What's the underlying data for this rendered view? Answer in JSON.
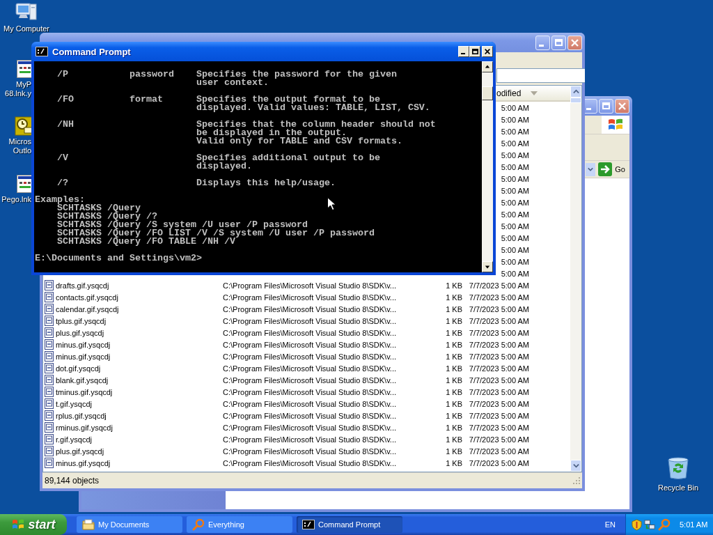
{
  "desktop": {
    "icons": [
      {
        "kind": "computer",
        "lines": [
          "My Computer"
        ]
      },
      {
        "kind": "shortcut",
        "lines": [
          "MyP",
          "68.lnk.y"
        ]
      },
      {
        "kind": "outlook",
        "lines": [
          "Micros",
          "Outlo"
        ]
      },
      {
        "kind": "shortcut",
        "lines": [
          "Pego.lnk"
        ]
      }
    ],
    "recycle_bin": {
      "label": "Recycle Bin"
    }
  },
  "explorer_window": {
    "go_button": "Go"
  },
  "everything_window": {
    "column_header": "odified",
    "partial_rows": [
      {
        "modified": "5:00 AM"
      },
      {
        "modified": "5:00 AM"
      },
      {
        "modified": "5:00 AM"
      },
      {
        "modified": "5:00 AM"
      },
      {
        "modified": "5:00 AM"
      },
      {
        "modified": "5:00 AM"
      },
      {
        "modified": "5:00 AM"
      },
      {
        "modified": "5:00 AM"
      },
      {
        "modified": "5:00 AM"
      },
      {
        "modified": "5:00 AM"
      },
      {
        "modified": "5:00 AM"
      },
      {
        "modified": "5:00 AM"
      },
      {
        "modified": "5:00 AM"
      },
      {
        "modified": "5:00 AM"
      },
      {
        "modified": "5:00 AM"
      }
    ],
    "rows": [
      {
        "name": "drafts.gif.ysqcdj",
        "path": "C:\\Program Files\\Microsoft Visual Studio 8\\SDK\\v...",
        "size": "1 KB",
        "modified": "7/7/2023 5:00 AM"
      },
      {
        "name": "contacts.gif.ysqcdj",
        "path": "C:\\Program Files\\Microsoft Visual Studio 8\\SDK\\v...",
        "size": "1 KB",
        "modified": "7/7/2023 5:00 AM"
      },
      {
        "name": "calendar.gif.ysqcdj",
        "path": "C:\\Program Files\\Microsoft Visual Studio 8\\SDK\\v...",
        "size": "1 KB",
        "modified": "7/7/2023 5:00 AM"
      },
      {
        "name": "tplus.gif.ysqcdj",
        "path": "C:\\Program Files\\Microsoft Visual Studio 8\\SDK\\v...",
        "size": "1 KB",
        "modified": "7/7/2023 5:00 AM"
      },
      {
        "name": "plus.gif.ysqcdj",
        "path": "C:\\Program Files\\Microsoft Visual Studio 8\\SDK\\v...",
        "size": "1 KB",
        "modified": "7/7/2023 5:00 AM"
      },
      {
        "name": "minus.gif.ysqcdj",
        "path": "C:\\Program Files\\Microsoft Visual Studio 8\\SDK\\v...",
        "size": "1 KB",
        "modified": "7/7/2023 5:00 AM"
      },
      {
        "name": "minus.gif.ysqcdj",
        "path": "C:\\Program Files\\Microsoft Visual Studio 8\\SDK\\v...",
        "size": "1 KB",
        "modified": "7/7/2023 5:00 AM"
      },
      {
        "name": "dot.gif.ysqcdj",
        "path": "C:\\Program Files\\Microsoft Visual Studio 8\\SDK\\v...",
        "size": "1 KB",
        "modified": "7/7/2023 5:00 AM"
      },
      {
        "name": "blank.gif.ysqcdj",
        "path": "C:\\Program Files\\Microsoft Visual Studio 8\\SDK\\v...",
        "size": "1 KB",
        "modified": "7/7/2023 5:00 AM"
      },
      {
        "name": "tminus.gif.ysqcdj",
        "path": "C:\\Program Files\\Microsoft Visual Studio 8\\SDK\\v...",
        "size": "1 KB",
        "modified": "7/7/2023 5:00 AM"
      },
      {
        "name": "t.gif.ysqcdj",
        "path": "C:\\Program Files\\Microsoft Visual Studio 8\\SDK\\v...",
        "size": "1 KB",
        "modified": "7/7/2023 5:00 AM"
      },
      {
        "name": "rplus.gif.ysqcdj",
        "path": "C:\\Program Files\\Microsoft Visual Studio 8\\SDK\\v...",
        "size": "1 KB",
        "modified": "7/7/2023 5:00 AM"
      },
      {
        "name": "rminus.gif.ysqcdj",
        "path": "C:\\Program Files\\Microsoft Visual Studio 8\\SDK\\v...",
        "size": "1 KB",
        "modified": "7/7/2023 5:00 AM"
      },
      {
        "name": "r.gif.ysqcdj",
        "path": "C:\\Program Files\\Microsoft Visual Studio 8\\SDK\\v...",
        "size": "1 KB",
        "modified": "7/7/2023 5:00 AM"
      },
      {
        "name": "plus.gif.ysqcdj",
        "path": "C:\\Program Files\\Microsoft Visual Studio 8\\SDK\\v...",
        "size": "1 KB",
        "modified": "7/7/2023 5:00 AM"
      },
      {
        "name": "minus.gif.ysqcdj",
        "path": "C:\\Program Files\\Microsoft Visual Studio 8\\SDK\\v...",
        "size": "1 KB",
        "modified": "7/7/2023 5:00 AM"
      }
    ],
    "status_bar": "89,144 objects"
  },
  "command_prompt": {
    "title": "Command Prompt",
    "blocks": [
      {
        "lines": [
          "    /P           password    Specifies the password for the given",
          "                             user context."
        ]
      },
      {
        "lines": [
          "    /FO          format      Specifies the output format to be",
          "                             displayed. Valid values: TABLE, LIST, CSV."
        ]
      },
      {
        "lines": [
          "    /NH                      Specifies that the column header should not",
          "                             be displayed in the output.",
          "                             Valid only for TABLE and CSV formats."
        ]
      },
      {
        "lines": [
          "    /V                       Specifies additional output to be",
          "                             displayed."
        ]
      },
      {
        "lines": [
          "    /?                       Displays this help/usage."
        ]
      },
      {
        "lines": [
          "Examples:",
          "    SCHTASKS /Query",
          "    SCHTASKS /Query /?",
          "    SCHTASKS /Query /S system /U user /P password",
          "    SCHTASKS /Query /FO LIST /V /S system /U user /P password",
          "    SCHTASKS /Query /FO TABLE /NH /V"
        ]
      },
      {
        "lines": [
          "E:\\Documents and Settings\\vm2>"
        ]
      }
    ]
  },
  "taskbar": {
    "start": "start",
    "tasks": [
      {
        "kind": "folder",
        "label": "My Documents",
        "selected": false
      },
      {
        "kind": "search",
        "label": "Everything",
        "selected": false
      },
      {
        "kind": "console",
        "label": "Command Prompt",
        "selected": true
      }
    ],
    "language": "EN",
    "clock": "5:01 AM"
  }
}
